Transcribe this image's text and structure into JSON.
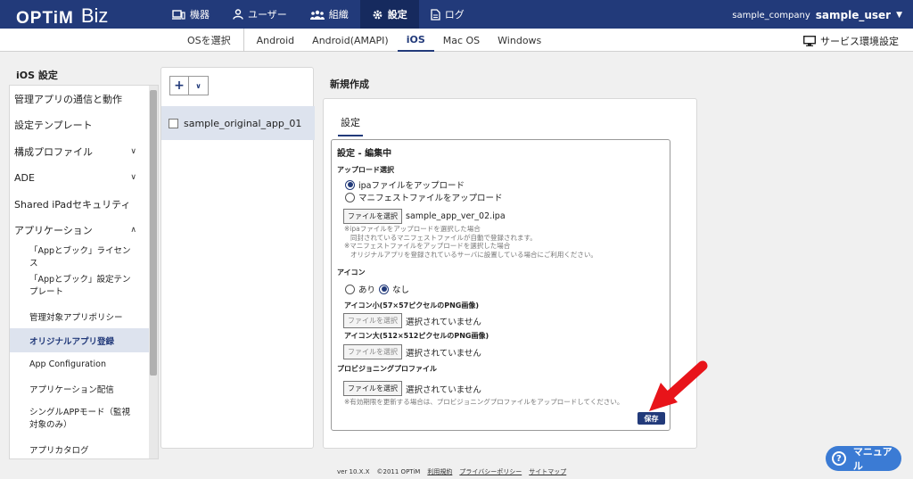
{
  "header": {
    "logo": "OPTiM",
    "logo_suffix": "Biz",
    "nav": [
      {
        "label": "機器",
        "icon": "device-icon"
      },
      {
        "label": "ユーザー",
        "icon": "user-icon"
      },
      {
        "label": "組織",
        "icon": "organization-icon"
      },
      {
        "label": "設定",
        "icon": "gear-icon"
      },
      {
        "label": "ログ",
        "icon": "log-icon"
      }
    ],
    "company": "sample_company",
    "username": "sample_user"
  },
  "subnav": {
    "os_select": "OSを選択",
    "tabs": [
      "Android",
      "Android(AMAPI)",
      "iOS",
      "Mac OS",
      "Windows"
    ],
    "active_tab": "iOS",
    "service_settings": "サービス環境設定"
  },
  "sidebar": {
    "title": "iOS 設定",
    "items": [
      {
        "label": "管理アプリの通信と動作"
      },
      {
        "label": "設定テンプレート"
      },
      {
        "label": "構成プロファイル",
        "chevron": "∨"
      },
      {
        "label": "ADE",
        "chevron": "∨"
      },
      {
        "label": "Shared iPadセキュリティ"
      },
      {
        "label": "アプリケーション",
        "chevron": "∧"
      },
      {
        "label": "「Appとブック」ライセンス"
      },
      {
        "label": "「Appとブック」設定テンプレート"
      },
      {
        "label": "管理対象アプリポリシー"
      },
      {
        "label": "オリジナルアプリ登録"
      },
      {
        "label": "App Configuration"
      },
      {
        "label": "アプリケーション配信"
      },
      {
        "label": "シングルAPPモード（監視対象のみ）"
      },
      {
        "label": "アプリカタログ"
      }
    ]
  },
  "list": {
    "add_label": "+",
    "dropdown_label": "∨",
    "items": [
      "sample_original_app_01"
    ]
  },
  "form": {
    "heading": "新規作成",
    "tab": "設定",
    "edit_title": "設定 - 編集中",
    "upload_label": "アップロード選択",
    "upload_opt1": "ipaファイルをアップロード",
    "upload_opt2": "マニフェストファイルをアップロード",
    "file_btn": "ファイルを選択",
    "ipa_file": "sample_app_ver_02.ipa",
    "note1": "※ipaファイルをアップロードを選択した場合",
    "note2": "同封されているマニフェストファイルが自動で登録されます。",
    "note3": "※マニフェストファイルをアップロードを選択した場合",
    "note4": "オリジナルアプリを登録されているサーバに設置している場合にご利用ください。",
    "icon_label": "アイコン",
    "icon_yes": "あり",
    "icon_no": "なし",
    "icon_small_label": "アイコン小(57×57ピクセルのPNG画像)",
    "icon_large_label": "アイコン大(512×512ピクセルのPNG画像)",
    "not_selected": "選択されていません",
    "prov_label": "プロビジョニングプロファイル",
    "prov_note": "※有効期限を更新する場合は、プロビジョニングプロファイルをアップロードしてください。",
    "save": "保存"
  },
  "footer": {
    "version": "ver 10.X.X",
    "copyright": "©2011 OPTiM",
    "terms": "利用規約",
    "privacy": "プライバシーポリシー",
    "sitemap": "サイトマップ"
  },
  "manual_button": "マニュアル",
  "colors": {
    "primary": "#223a7a",
    "arrow": "#e8141a",
    "manual": "#3b7bd4"
  }
}
